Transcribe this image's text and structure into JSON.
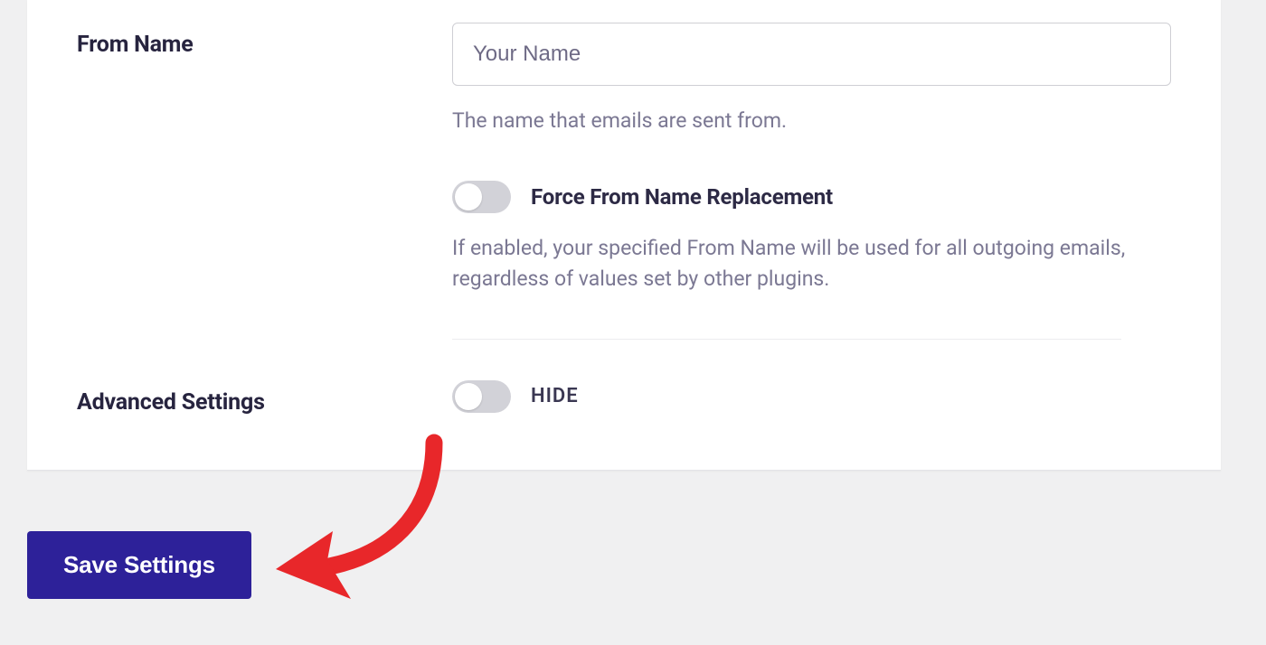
{
  "from_name": {
    "label": "From Name",
    "placeholder": "Your Name",
    "value": "",
    "help": "The name that emails are sent from.",
    "force_toggle": {
      "label": "Force From Name Replacement",
      "enabled": false,
      "help": "If enabled, your specified From Name will be used for all outgoing emails, regardless of values set by other plugins."
    }
  },
  "advanced": {
    "label": "Advanced Settings",
    "toggle": {
      "enabled": false,
      "status": "HIDE"
    }
  },
  "actions": {
    "save": "Save Settings"
  },
  "annotation": {
    "type": "arrow",
    "color": "#e8272a",
    "target": "save-settings-button"
  }
}
